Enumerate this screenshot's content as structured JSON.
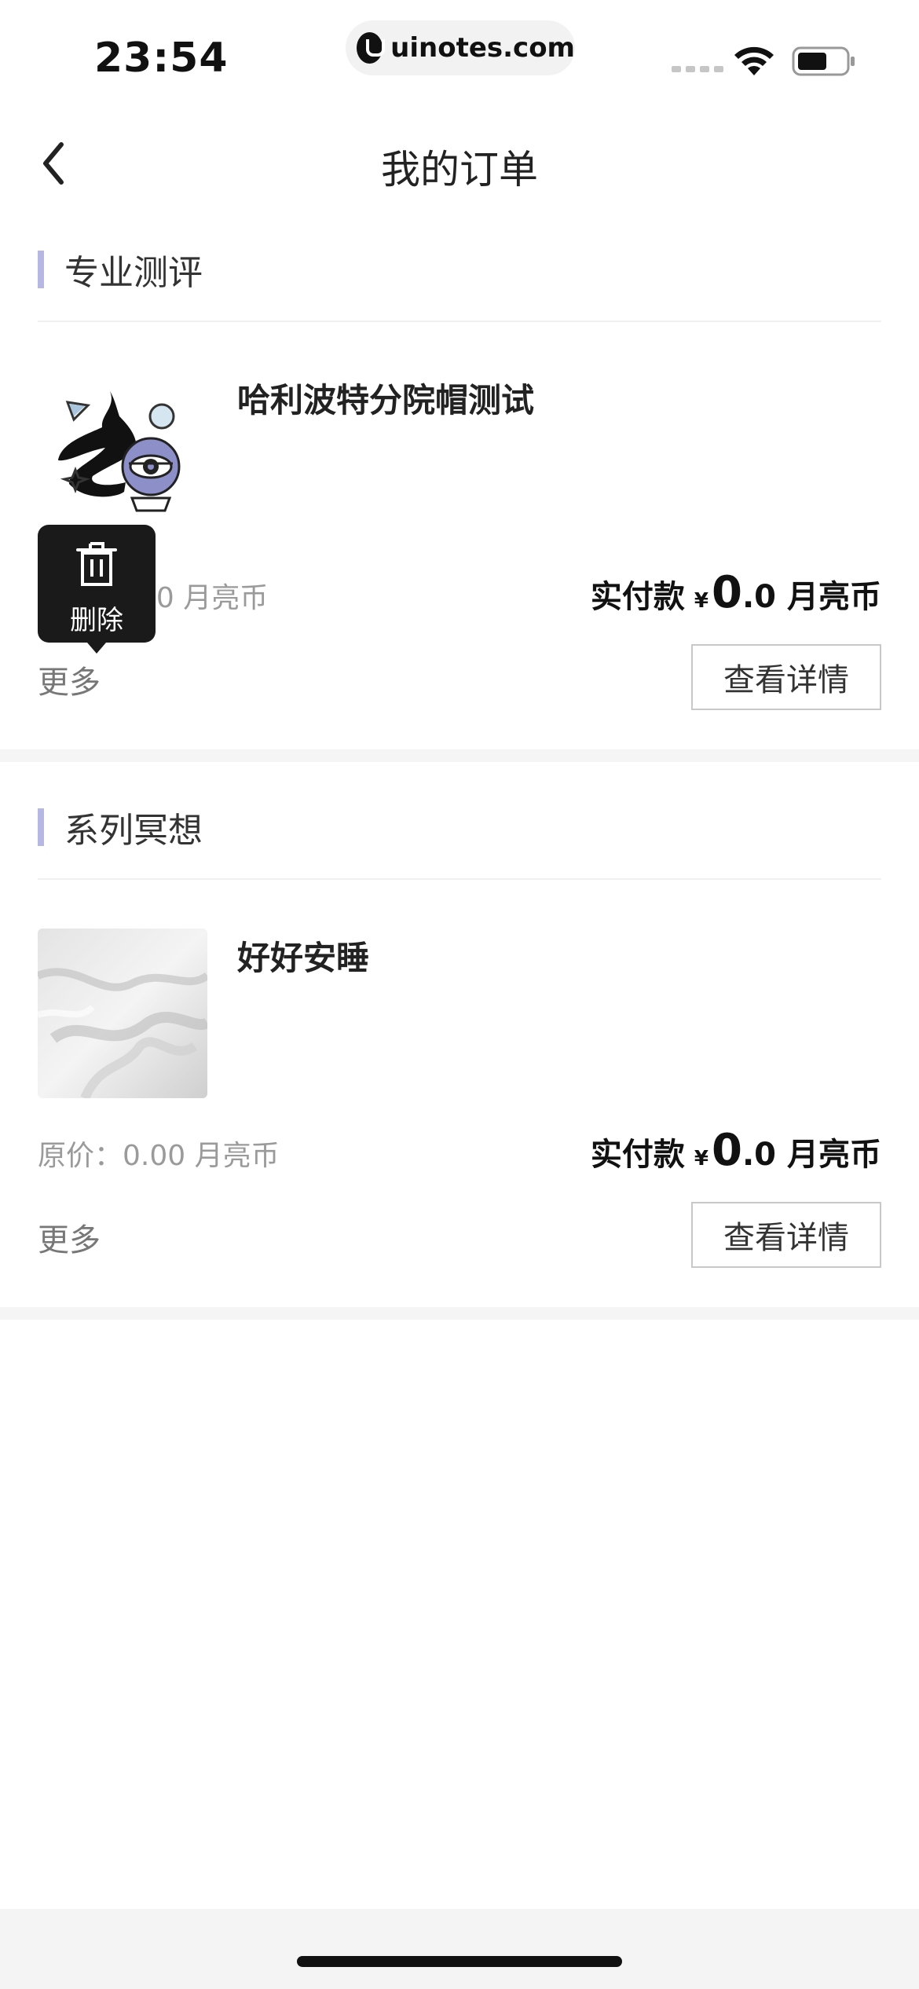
{
  "status_bar": {
    "time": "23:54",
    "url": "uinotes.com"
  },
  "nav": {
    "title": "我的订单"
  },
  "orders": [
    {
      "category": "专业测评",
      "title": "哈利波特分院帽测试",
      "original_price": "原价：0.00 月亮币",
      "original_price_visible": "00  月亮币",
      "paid_label": "实付款",
      "currency": "¥",
      "amount_int": "0",
      "amount_dec": ".0",
      "unit": "月亮币",
      "more": "更多",
      "detail_button": "查看详情"
    },
    {
      "category": "系列冥想",
      "title": "好好安睡",
      "original_price": "原价：0.00  月亮币",
      "paid_label": "实付款",
      "currency": "¥",
      "amount_int": "0",
      "amount_dec": ".0",
      "unit": "月亮币",
      "more": "更多",
      "detail_button": "查看详情"
    }
  ],
  "tooltip": {
    "label": "删除",
    "icon": "trash-icon"
  },
  "colors": {
    "accent_bar": "#b6b8e3",
    "illustration_purple": "#8d8fc9"
  }
}
